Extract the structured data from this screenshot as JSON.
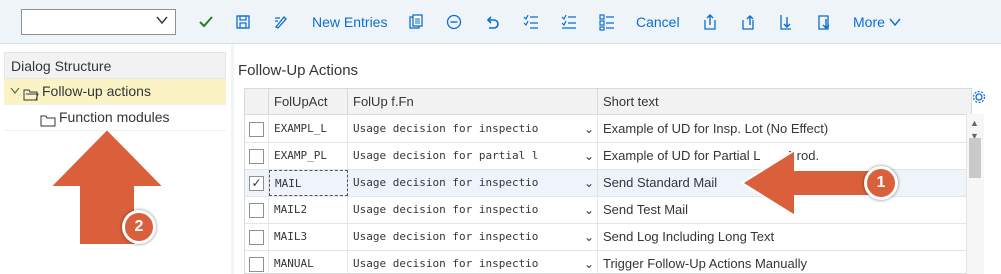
{
  "toolbar": {
    "select_value": "",
    "new_entries": "New Entries",
    "cancel": "Cancel",
    "more": "More"
  },
  "dialog_structure": {
    "title": "Dialog Structure",
    "items": [
      {
        "label": "Follow-up actions",
        "selected": true
      },
      {
        "label": "Function modules",
        "selected": false
      }
    ]
  },
  "main": {
    "title": "Follow-Up Actions",
    "columns": [
      "FolUpAct",
      "FolUp f.Fn",
      "Short text"
    ],
    "rows": [
      {
        "code": "EXAMPL_L",
        "function": "Usage decision for inspectio",
        "text": "Example of UD for Insp. Lot (No Effect)",
        "checked": false
      },
      {
        "code": "EXAMP_PL",
        "function": "Usage decision for partial l",
        "text": "Example of UD for Partial L",
        "checked": false
      },
      {
        "code": "MAIL",
        "function": "Usage decision for inspectio",
        "text": "Send Standard Mail",
        "checked": true
      },
      {
        "code": "MAIL2",
        "function": "Usage decision for inspectio",
        "text": "Send Test Mail",
        "checked": false
      },
      {
        "code": "MAIL3",
        "function": "Usage decision for inspectio",
        "text": "Send Log Including Long Text",
        "checked": false
      },
      {
        "code": "MANUAL",
        "function": "Usage decision for inspectio",
        "text": "Trigger Follow-Up Actions Manually",
        "checked": false
      }
    ],
    "row2_tail": "Prod."
  },
  "annotations": {
    "badge1": "1",
    "badge2": "2",
    "color": "#d9603b"
  },
  "colors": {
    "accent": "#0a6ed1",
    "selection": "#fcf3c4",
    "toolbar_bg": "#eff4f9"
  }
}
